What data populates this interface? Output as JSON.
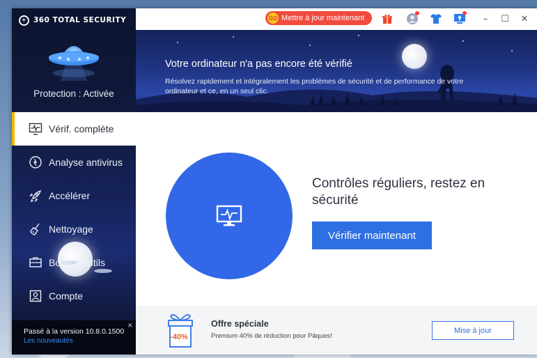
{
  "app": {
    "brand_name": "360 TOTAL SECURITY",
    "protection_status": "Protection : Activée"
  },
  "titlebar": {
    "update_label": "Mettre à jour maintenant",
    "update_badge": "GO",
    "icons": [
      "gift-icon",
      "avatar-icon",
      "tshirt-icon",
      "upload-icon"
    ],
    "minimize": "–",
    "maximize": "☐",
    "close": "✕"
  },
  "sidebar": {
    "items": [
      {
        "label": "Vérif. complète",
        "icon": "monitor-pulse-icon",
        "active": true
      },
      {
        "label": "Analyse antivirus",
        "icon": "scan-icon",
        "active": false
      },
      {
        "label": "Accélérer",
        "icon": "rocket-icon",
        "active": false
      },
      {
        "label": "Nettoyage",
        "icon": "broom-icon",
        "active": false
      },
      {
        "label": "Boîte à outils",
        "icon": "toolbox-icon",
        "active": false
      },
      {
        "label": "Compte",
        "icon": "account-icon",
        "active": false
      }
    ],
    "version_text": "Passé à la version 10.8.0.1500",
    "version_link": "Les nouveautés",
    "version_close": "×"
  },
  "banner": {
    "title": "Votre ordinateur n'a pas encore été vérifié",
    "subtitle_line1": "Résolvez rapidement et intégralement les problèmes de sécurité et de performance de votre",
    "subtitle_line2": "ordinateur et ce, en un seul clic."
  },
  "main": {
    "title_line1": "Contrôles réguliers, restez en",
    "title_line2": "sécurité",
    "check_button": "Vérifier maintenant"
  },
  "offer": {
    "discount": "-40%",
    "title": "Offre spéciale",
    "subtitle": "Premium 40% de réduction pour Pâques!",
    "button": "Mise à jour"
  },
  "colors": {
    "accent": "#2f6fe4",
    "update_pill": "#f24a3d",
    "active_marker": "#f3b800"
  }
}
